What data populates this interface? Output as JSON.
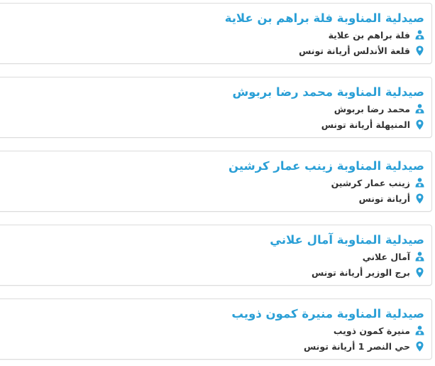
{
  "colors": {
    "title": "#2a9fd6",
    "icon": "#2a9fd6",
    "text": "#333333",
    "border": "#dcdcdc"
  },
  "pharmacies": [
    {
      "title": "صيدلية المناوبة فلة براهم بن علاية",
      "owner": "فلة براهم بن علاية",
      "address": "قلعة الأندلس أريانة تونس",
      "owner_icon": "pharmacist-icon",
      "address_icon": "location-pin-icon"
    },
    {
      "title": "صيدلية المناوبة محمد رضا بربوش",
      "owner": "محمد رضا بربوش",
      "address": "المنيهلة أريانة تونس",
      "owner_icon": "pharmacist-icon",
      "address_icon": "location-pin-icon"
    },
    {
      "title": "صيدلية المناوبة زينب عمار كرشين",
      "owner": "زينب عمار كرشين",
      "address": "أريانة تونس",
      "owner_icon": "pharmacist-icon",
      "address_icon": "location-pin-icon"
    },
    {
      "title": "صيدلية المناوبة آمال علاني",
      "owner": "آمال علاني",
      "address": "برج الوزير أريانة تونس",
      "owner_icon": "pharmacist-icon",
      "address_icon": "location-pin-icon"
    },
    {
      "title": "صيدلية المناوبة منيرة كمون ذويب",
      "owner": "منيرة كمون ذويب",
      "address": "حي النصر 1 أريانة تونس",
      "owner_icon": "pharmacist-icon",
      "address_icon": "location-pin-icon"
    }
  ]
}
